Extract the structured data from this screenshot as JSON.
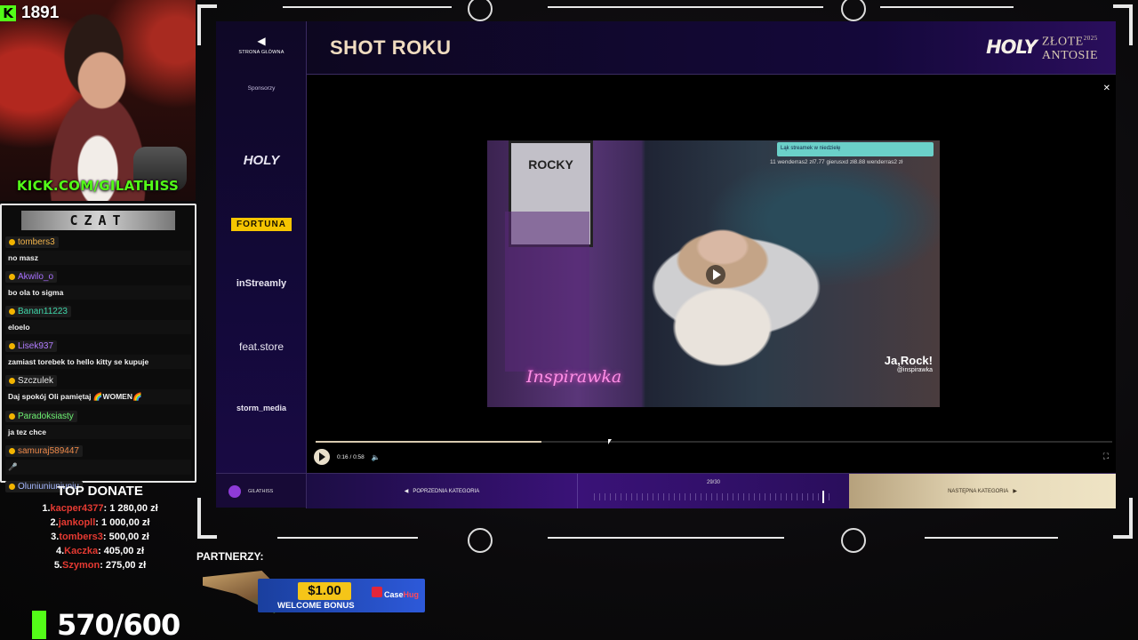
{
  "stream": {
    "viewers": "1891",
    "kick_url": "KICK.COM/GILATHISS",
    "chat_title": "CZAT",
    "chat": [
      {
        "user": "tombers3",
        "color": "#f0b24a",
        "text": "no masz"
      },
      {
        "user": "Akwilo_o",
        "color": "#a970ff",
        "text": "bo ola to sigma"
      },
      {
        "user": "Banan11223",
        "color": "#3fd6a9",
        "text": "eloelo"
      },
      {
        "user": "Lisek937",
        "color": "#b17dff",
        "text": "zamiast torebek to hello kitty se kupuje"
      },
      {
        "user": "Szczulek",
        "color": "#e5e5e5",
        "text": "Daj spokój Oli pamiętaj 🌈WOMEN🌈"
      },
      {
        "user": "Paradoksiasty",
        "color": "#6df072",
        "text": "ja tez chce"
      },
      {
        "user": "samuraj589447",
        "color": "#f08a4a",
        "text": "🎤"
      },
      {
        "user": "Oluniuniuniuniu",
        "color": "#a6b8ff",
        "text": ""
      }
    ],
    "top_donate": {
      "title": "TOP DONATE",
      "entries": [
        {
          "rank": "1.",
          "name": "kacper4377",
          "amount": ": 1 280,00 zł"
        },
        {
          "rank": "2.",
          "name": "jankopll",
          "amount": ": 1 000,00 zł"
        },
        {
          "rank": "3.",
          "name": "tombers3",
          "amount": ": 500,00 zł"
        },
        {
          "rank": "4.",
          "name": "Kaczka",
          "amount": ": 405,00 zł"
        },
        {
          "rank": "5.",
          "name": "Szymon",
          "amount": ": 275,00 zł"
        }
      ]
    },
    "goal": "570/600",
    "partners_label": "PARTNERZY:",
    "promo": {
      "price": "$1.00",
      "bonus": "WELCOME BONUS",
      "brand_a": "Case",
      "brand_b": "Hug"
    }
  },
  "app": {
    "back_label": "STRONA GŁÓWNA",
    "sponsors_label": "Sponsorzy",
    "sponsors": [
      "HOLY",
      "FORTUNA",
      "inStreamly",
      "feat.store",
      "storm_media"
    ],
    "title": "SHOT ROKU",
    "logo": {
      "brand": "HOLY",
      "line1": "ZŁOTE",
      "year": "2025",
      "line2": "ANTOSIE"
    },
    "video": {
      "poster_text": "ROCKY",
      "neon_text": "Inspirawka",
      "top_bar": "Ląk streamek w niedzielę",
      "tickers": "11  wenderras2 zł7.77   gierusxd zł8.88   wenderras2 zł",
      "watermark": "Ja,Rock!",
      "watermark_handle": "@inspirawka",
      "time": "0:16 / 0:58",
      "progress": 0.284
    },
    "footer": {
      "user": "GILATHISS",
      "prev": "POPRZEDNIA KATEGORIA",
      "counter": "29/30",
      "next": "NASTĘPNA KATEGORIA"
    }
  }
}
